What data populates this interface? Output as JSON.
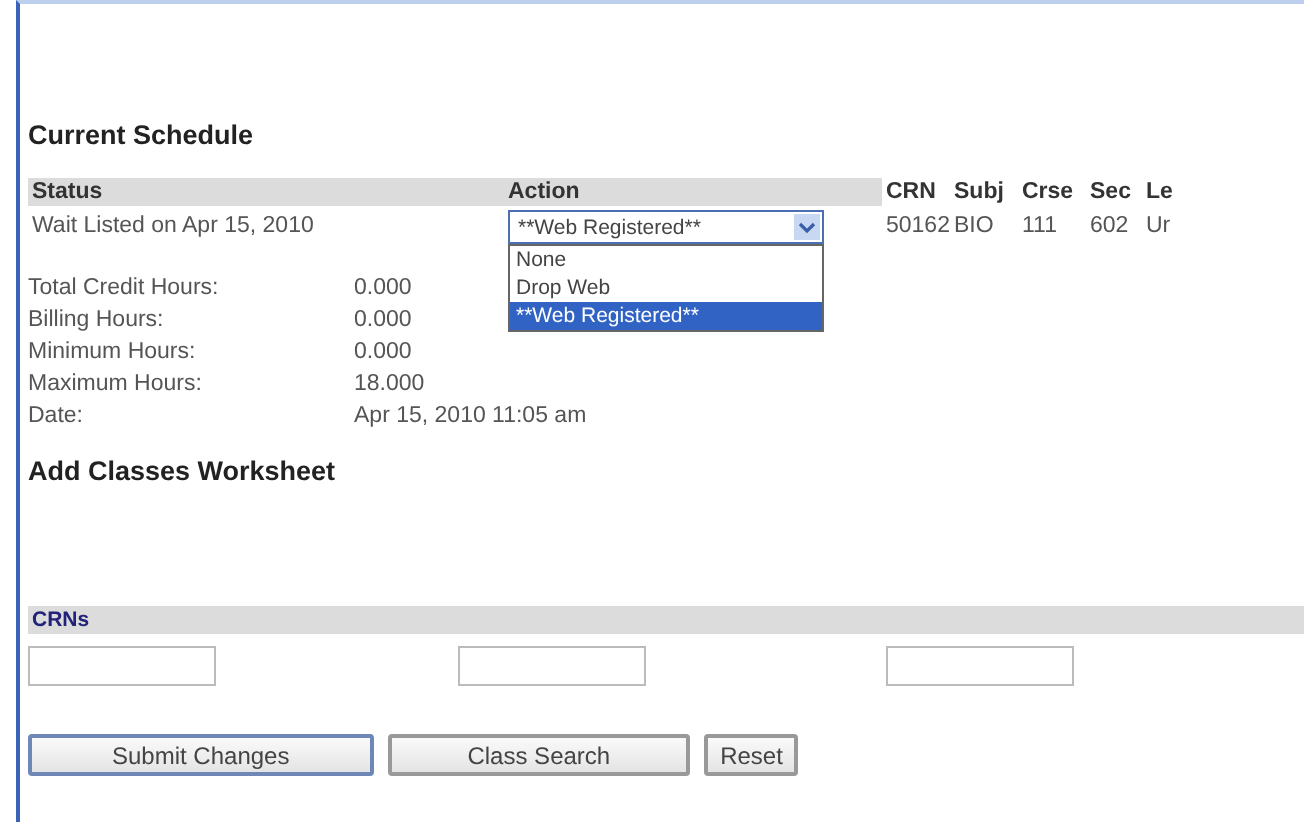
{
  "current_schedule": {
    "title": "Current Schedule",
    "columns": [
      "Status",
      "Action",
      "CRN",
      "Subj",
      "Crse",
      "Sec",
      "Le"
    ],
    "rows": [
      {
        "status": "Wait Listed on Apr 15, 2010",
        "action": {
          "value": "**Web Registered**",
          "expanded": true,
          "options": [
            {
              "label": "None",
              "selected": false
            },
            {
              "label": "Drop Web",
              "selected": false
            },
            {
              "label": "**Web Registered**",
              "selected": true
            }
          ]
        },
        "crn": "50162",
        "subj": "BIO",
        "crse": "111",
        "sec": "602",
        "column_7": "Ur"
      }
    ],
    "summary": [
      {
        "label": "Total Credit Hours:",
        "value": "0.000"
      },
      {
        "label": "Billing Hours:",
        "value": "0.000"
      },
      {
        "label": "Minimum Hours:",
        "value": "0.000"
      },
      {
        "label": "Maximum Hours:",
        "value": "18.000"
      },
      {
        "label": "Date:",
        "value": "Apr 15, 2010 11:05 am"
      }
    ]
  },
  "add_classes": {
    "title": "Add Classes Worksheet",
    "crns_label": "CRNs",
    "crn_fields": [
      {
        "kind": "input"
      },
      {
        "kind": "input"
      },
      {
        "kind": "input"
      }
    ]
  },
  "buttons": [
    "Submit Changes",
    "Class Search",
    "Reset"
  ]
}
